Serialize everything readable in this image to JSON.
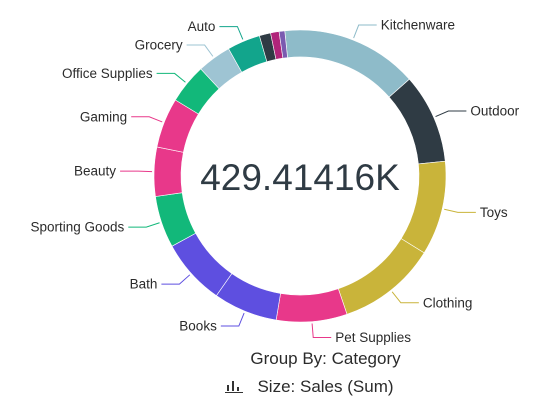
{
  "chart_data": {
    "type": "pie",
    "variant": "donut",
    "center_label": "429.41416K",
    "categories": [
      "Kitchenware",
      "Outdoor",
      "Toys",
      "Clothing",
      "Pet Supplies",
      "Books",
      "Bath",
      "Sporting Goods",
      "Beauty",
      "Gaming",
      "Office Supplies",
      "Grocery",
      "Auto",
      "",
      "",
      ""
    ],
    "values": [
      14.5,
      9.5,
      10.0,
      10.5,
      7.5,
      6.8,
      7.0,
      5.5,
      5.2,
      5.3,
      4.2,
      3.6,
      3.5,
      1.2,
      0.9,
      0.6
    ],
    "colors": [
      "#8ebbc9",
      "#2f3b44",
      "#c9b43a",
      "#c9b43a",
      "#e8388a",
      "#5e4fe0",
      "#5e4fe0",
      "#12b87a",
      "#e8388a",
      "#e8388a",
      "#12b87a",
      "#9ec4d3",
      "#12a58c",
      "#2f3b44",
      "#b0247a",
      "#7a5ab0"
    ],
    "legend": "none"
  },
  "footer": {
    "group_by": "Group By: Category",
    "size": "Size: Sales (Sum)"
  },
  "icons": {
    "size_icon": "bar-chart-icon"
  }
}
